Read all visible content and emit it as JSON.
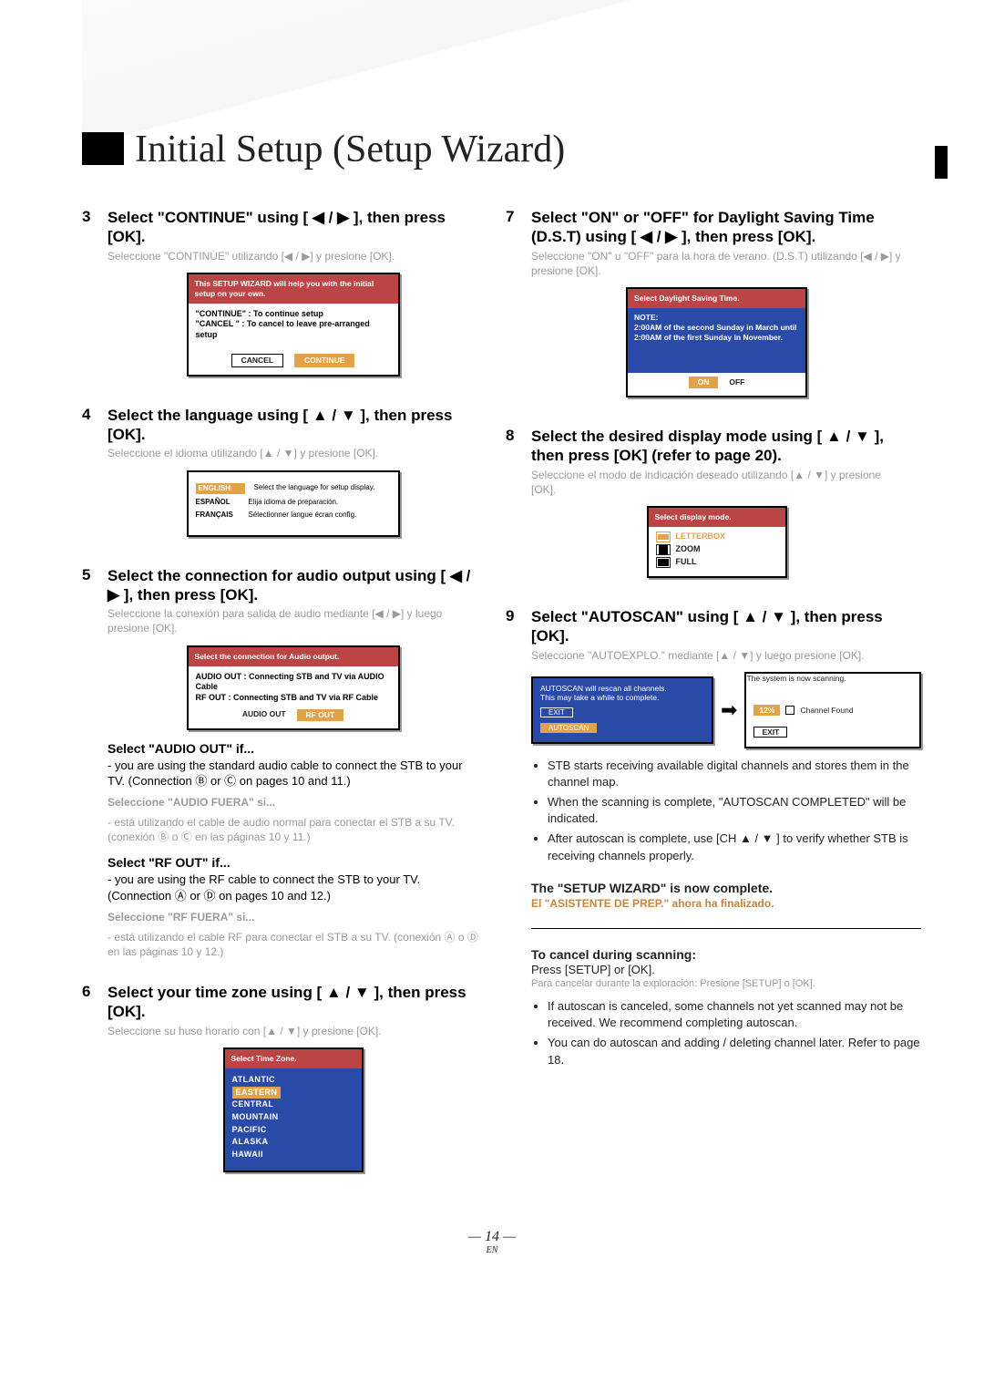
{
  "title": "Initial Setup (Setup Wizard)",
  "page_number": "14",
  "page_lang": "EN",
  "steps": {
    "s3": {
      "num": "3",
      "head_a": "Select \"CONTINUE\" using [ ◀ / ▶ ], then press [OK].",
      "sub": "Seleccione \"CONTINÚE\" utilizando [◀ / ▶] y presione [OK].",
      "screen": {
        "top": "This SETUP WIZARD will help you with the initial setup on your own.",
        "l1": "\"CONTINUE\" : To continue setup",
        "l2": "\"CANCEL   \" : To cancel to leave pre-arranged setup",
        "cancel": "CANCEL",
        "cont": "CONTINUE"
      }
    },
    "s4": {
      "num": "4",
      "head": "Select the language using [ ▲ / ▼ ], then press [OK].",
      "sub": "Seleccione el idioma utilizando [▲ / ▼] y presione [OK].",
      "screen": {
        "row1a": "ENGLISH",
        "row1b": "Select the language for setup display.",
        "row2a": "ESPAÑOL",
        "row2b": "Elija idioma de preparación.",
        "row3a": "FRANÇAIS",
        "row3b": "Sélectionner langue écran config."
      }
    },
    "s5": {
      "num": "5",
      "head": "Select the connection for audio output using [ ◀ / ▶ ], then press [OK].",
      "sub": "Seleccione la conexión para salida de audio mediante [◀ / ▶] y luego presione [OK].",
      "screen": {
        "top": "Select the connection for Audio output.",
        "a1": "AUDIO OUT : Connecting STB and TV via AUDIO Cable",
        "a2": "RF OUT       : Connecting STB and TV via RF Cable",
        "b1": "AUDIO OUT",
        "b2": "RF OUT"
      },
      "ah": "Select \"AUDIO OUT\" if...",
      "at": "- you are using the standard audio cable to connect the STB to your TV. (Connection Ⓑ or Ⓒ on pages 10 and 11.)",
      "ag1": "Seleccione \"AUDIO FUERA\" si...",
      "ag2": "- está utilizando el cable de audio normal para conectar el STB a su TV. (conexión Ⓑ o Ⓒ en las páginas 10 y 11.)",
      "rh": "Select \"RF OUT\" if...",
      "rt": "- you are using the RF cable to connect the STB to your TV. (Connection Ⓐ or Ⓓ on pages 10 and 12.)",
      "rg1": "Seleccione \"RF FUERA\" si...",
      "rg2": "- está utilizando el cable RF para conectar el STB a su TV. (conexión Ⓐ o Ⓓ en las páginas 10 y 12.)"
    },
    "s6": {
      "num": "6",
      "head": "Select your time zone using [ ▲ / ▼ ], then press [OK].",
      "sub": "Seleccione su huso horario con [▲ / ▼] y presione [OK].",
      "screen": {
        "top": "Select Time Zone.",
        "items": [
          "ATLANTIC",
          "EASTERN",
          "CENTRAL",
          "MOUNTAIN",
          "PACIFIC",
          "ALASKA",
          "HAWAII"
        ],
        "active": 1
      }
    },
    "s7": {
      "num": "7",
      "head": "Select \"ON\" or \"OFF\" for Daylight Saving Time (D.S.T) using [ ◀ / ▶ ], then press [OK].",
      "sub": "Seleccione \"ON\" u \"OFF\" para la hora de verano. (D.S.T) utilizando [◀ / ▶] y presione [OK].",
      "screen": {
        "top": "Select Daylight Saving Time.",
        "note_t": "NOTE:",
        "note": "2:00AM of the second Sunday in March until 2:00AM of the first Sunday in November.",
        "on": "ON",
        "off": "OFF"
      }
    },
    "s8": {
      "num": "8",
      "head": "Select the desired display mode using [ ▲ / ▼ ], then press [OK] (refer to page 20).",
      "sub": "Seleccione el modo de indicación deseado utilizando [▲ / ▼] y presione [OK].",
      "screen": {
        "top": "Select display mode.",
        "r1": "LETTERBOX",
        "r2": "ZOOM",
        "r3": "FULL"
      }
    },
    "s9": {
      "num": "9",
      "head": "Select \"AUTOSCAN\" using [ ▲ / ▼ ], then press [OK].",
      "sub": "Seleccione \"AUTOEXPLO.\" mediante [▲ / ▼] y luego presione [OK].",
      "left": {
        "l1": "AUTOSCAN will rescan all channels.",
        "l2": "This may take a while to complete.",
        "exit": "EXIT",
        "auto": "AUTOSCAN"
      },
      "right": {
        "top": "The system is now scanning.",
        "pct": "12%",
        "cf": "Channel Found",
        "exit": "EXIT"
      },
      "bullets": [
        "STB starts receiving available digital channels and stores them in the channel map.",
        "When the scanning is complete, \"AUTOSCAN COMPLETED\" will be indicated.",
        "After autoscan is complete, use [CH ▲ / ▼ ] to verify whether STB is receiving channels properly."
      ],
      "done": "The \"SETUP WIZARD\" is now complete.",
      "done_es": "El \"ASISTENTE DE PREP.\" ahora ha finalizado.",
      "cancel_h": "To cancel during scanning:",
      "cancel_b": "Press [SETUP] or [OK].",
      "cancel_g": "Para cancelar durante la exploración: Presione [SETUP] o [OK].",
      "cbullets": [
        "If autoscan is canceled, some channels not yet scanned may not be received. We recommend completing autoscan.",
        "You can do autoscan and adding / deleting channel later. Refer to page 18."
      ]
    }
  }
}
